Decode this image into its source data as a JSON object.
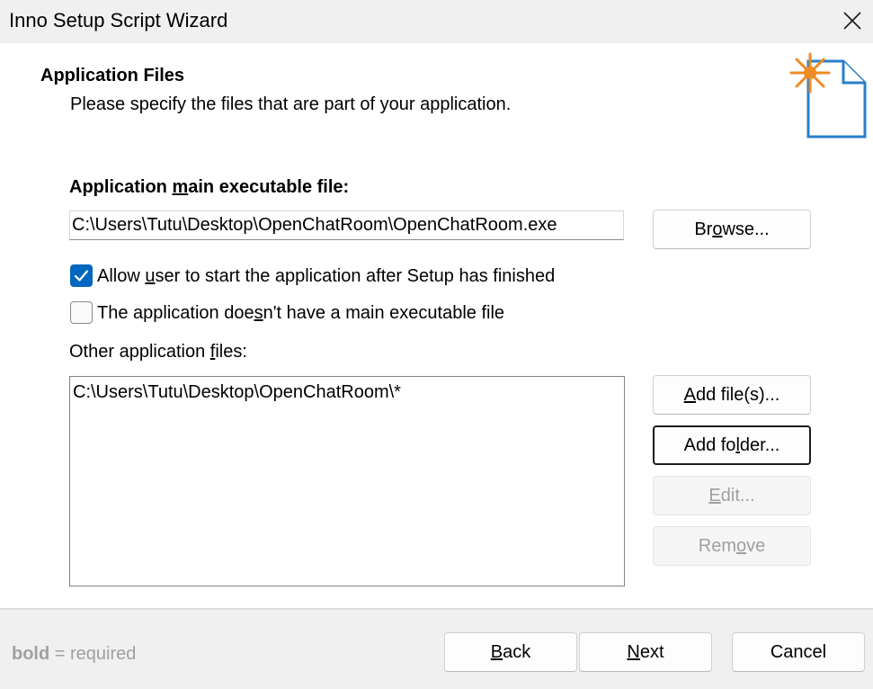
{
  "window": {
    "title": "Inno Setup Script Wizard",
    "close_icon": "close-icon"
  },
  "header": {
    "title": "Application Files",
    "subtitle": "Please specify the files that are part of your application.",
    "image_icon": "new-document-sparkle-icon",
    "accent_color": "#f08a24",
    "icon_color": "#2a7fc9"
  },
  "main_exe": {
    "label_pre": "Application ",
    "label_u": "m",
    "label_post": "ain executable file:",
    "value": "C:\\Users\\Tutu\\Desktop\\OpenChatRoom\\OpenChatRoom.exe",
    "browse_pre": "Br",
    "browse_u": "o",
    "browse_post": "wse..."
  },
  "options": {
    "allow_start": {
      "checked": true,
      "pre": "Allow ",
      "u": "u",
      "post": "ser to start the application after Setup has finished"
    },
    "no_main_exe": {
      "checked": false,
      "pre": "The application doe",
      "u": "s",
      "post": "n't have a main executable file"
    }
  },
  "other_files": {
    "label_pre": "Other application ",
    "label_u": "f",
    "label_post": "iles:",
    "items": [
      "C:\\Users\\Tutu\\Desktop\\OpenChatRoom\\*"
    ],
    "buttons": {
      "add_files": {
        "pre": "",
        "u": "A",
        "post": "dd file(s)...",
        "enabled": true
      },
      "add_folder": {
        "pre": "Add fo",
        "u": "l",
        "post": "der...",
        "enabled": true,
        "focused": true
      },
      "edit": {
        "pre": "",
        "u": "E",
        "post": "dit...",
        "enabled": false
      },
      "remove": {
        "pre": "Rem",
        "u": "o",
        "post": "ve",
        "enabled": false
      }
    }
  },
  "footer": {
    "note_bold": "bold",
    "note_rest": " = required",
    "back": {
      "pre": "",
      "u": "B",
      "post": "ack"
    },
    "next": {
      "pre": "",
      "u": "N",
      "post": "ext"
    },
    "cancel": "Cancel"
  },
  "colors": {
    "checkbox_checked": "#0067c0",
    "disabled_text": "#a0a0a0",
    "footer_bg": "#f0f0f0"
  }
}
